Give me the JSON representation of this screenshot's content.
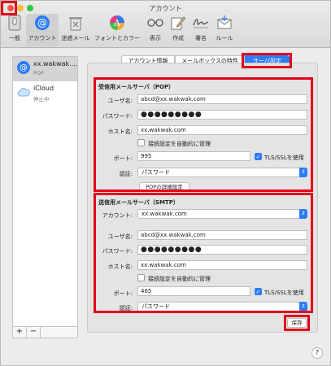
{
  "window": {
    "title": "アカウント"
  },
  "toolbar": {
    "items": [
      {
        "label": "一般",
        "icon": "general-icon"
      },
      {
        "label": "アカウント",
        "icon": "at-icon"
      },
      {
        "label": "迷惑メール",
        "icon": "junk-trash-icon"
      },
      {
        "label": "フォントとカラー",
        "icon": "font-color-icon"
      },
      {
        "label": "表示",
        "icon": "glasses-icon"
      },
      {
        "label": "作成",
        "icon": "pencil-icon"
      },
      {
        "label": "署名",
        "icon": "signature-icon"
      },
      {
        "label": "ルール",
        "icon": "rules-icon"
      }
    ]
  },
  "sidebar": {
    "accounts": [
      {
        "name": "xx.wakwak....",
        "sub": "POP",
        "icon": "at-icon"
      },
      {
        "name": "iCloud",
        "sub": "停止中",
        "icon": "cloud-icon"
      }
    ],
    "add_label": "+",
    "remove_label": "−"
  },
  "tabs": [
    {
      "label": "アカウント情報"
    },
    {
      "label": "メールボックスの特性"
    },
    {
      "label": "サーバ設定"
    }
  ],
  "incoming": {
    "title": "受信用メールサーバ（POP）",
    "username_label": "ユーザ名:",
    "username": "abcd@xx.wakwak.com",
    "password_label": "パスワード:",
    "password": "●●●●●●●●●",
    "host_label": "ホスト名:",
    "host": "xx.wakwak.com",
    "auto_manage_label": "接続設定を自動的に管理",
    "port_label": "ポート:",
    "port": "995",
    "tls_label": "TLS/SSLを使用",
    "auth_label": "認証:",
    "auth": "パスワード",
    "details_button": "POPの詳細設定"
  },
  "outgoing": {
    "title": "送信用メールサーバ（SMTP）",
    "account_label": "アカウント:",
    "account": "xx.wakwak.com",
    "username_label": "ユーザ名:",
    "username": "abcd@xx.wakwak.com",
    "password_label": "パスワード:",
    "password": "●●●●●●●●●",
    "host_label": "ホスト名:",
    "host": "xx.wakwak.com",
    "auto_manage_label": "接続設定を自動的に管理",
    "port_label": "ポート:",
    "port": "465",
    "tls_label": "TLS/SSLを使用",
    "auth_label": "認証:",
    "auth": "パスワード"
  },
  "save_label": "保存",
  "help_label": "?",
  "colors": {
    "accent": "#2e7cf6",
    "highlight": "#e3001b",
    "close": "#fc5753",
    "minimize": "#fdbc40",
    "zoom": "#33c748"
  }
}
